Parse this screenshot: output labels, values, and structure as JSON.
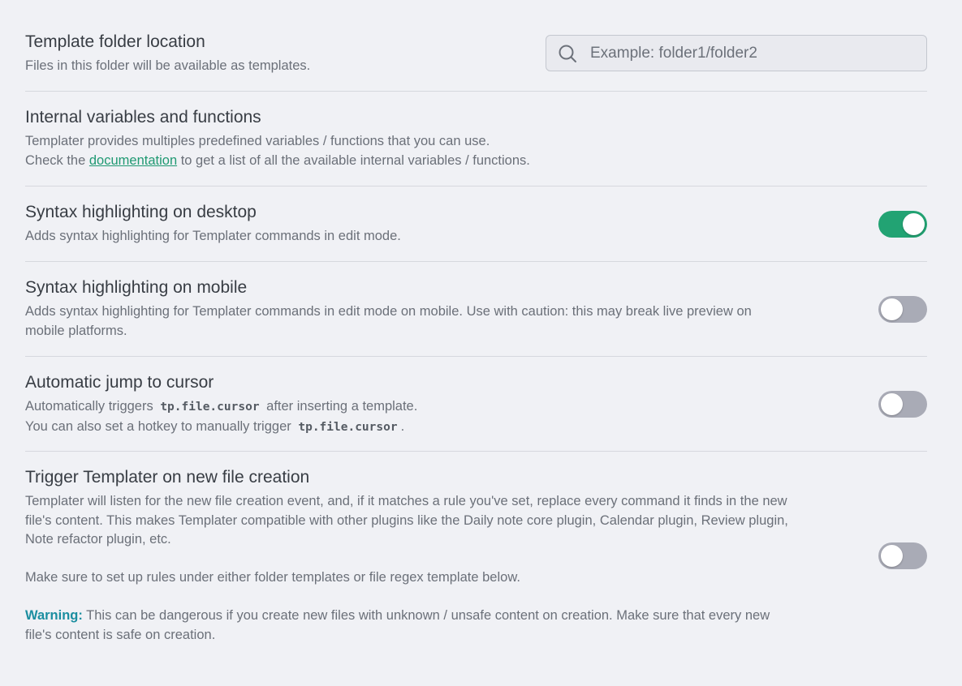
{
  "template_folder": {
    "name": "Template folder location",
    "desc": "Files in this folder will be available as templates.",
    "placeholder": "Example: folder1/folder2",
    "value": "",
    "icon": "search-icon"
  },
  "internal_vars": {
    "name": "Internal variables and functions",
    "desc_line1": "Templater provides multiples predefined variables / functions that you can use.",
    "desc_line2_prefix": "Check the ",
    "desc_link": "documentation",
    "desc_line2_suffix": " to get a list of all the available internal variables / functions."
  },
  "syntax_desktop": {
    "name": "Syntax highlighting on desktop",
    "desc": "Adds syntax highlighting for Templater commands in edit mode.",
    "enabled": true
  },
  "syntax_mobile": {
    "name": "Syntax highlighting on mobile",
    "desc_line1": "Adds syntax highlighting for Templater commands in edit mode on mobile. Use with caution: this may break live preview on",
    "desc_line2": "mobile platforms.",
    "enabled": false
  },
  "auto_jump": {
    "name": "Automatic jump to cursor",
    "desc_line1_prefix": "Automatically triggers",
    "code": "tp.file.cursor",
    "desc_line1_suffix": "after inserting a template.",
    "desc_line2_prefix": "You can also set a hotkey to manually trigger",
    "desc_line2_suffix": ".",
    "enabled": false
  },
  "trigger_new_file": {
    "name": "Trigger Templater on new file creation",
    "desc_p1_line1": "Templater will listen for the new file creation event, and, if it matches a rule you've set, replace every command it finds in the new",
    "desc_p1_line2": "file's content. This makes Templater compatible with other plugins like the Daily note core plugin, Calendar plugin, Review plugin,",
    "desc_p1_line3": "Note refactor plugin, etc.",
    "desc_p2": "Make sure to set up rules under either folder templates or file regex template below.",
    "warning_label": "Warning:",
    "desc_p3_line1": " This can be dangerous if you create new files with unknown / unsafe content on creation. Make sure that every new",
    "desc_p3_line2": "file's content is safe on creation.",
    "enabled": false
  },
  "colors": {
    "accent": "#22a373",
    "link": "#1f9972",
    "warning": "#1b8ea0",
    "toggle_off": "#a9abb6",
    "background": "#f0f1f5"
  }
}
